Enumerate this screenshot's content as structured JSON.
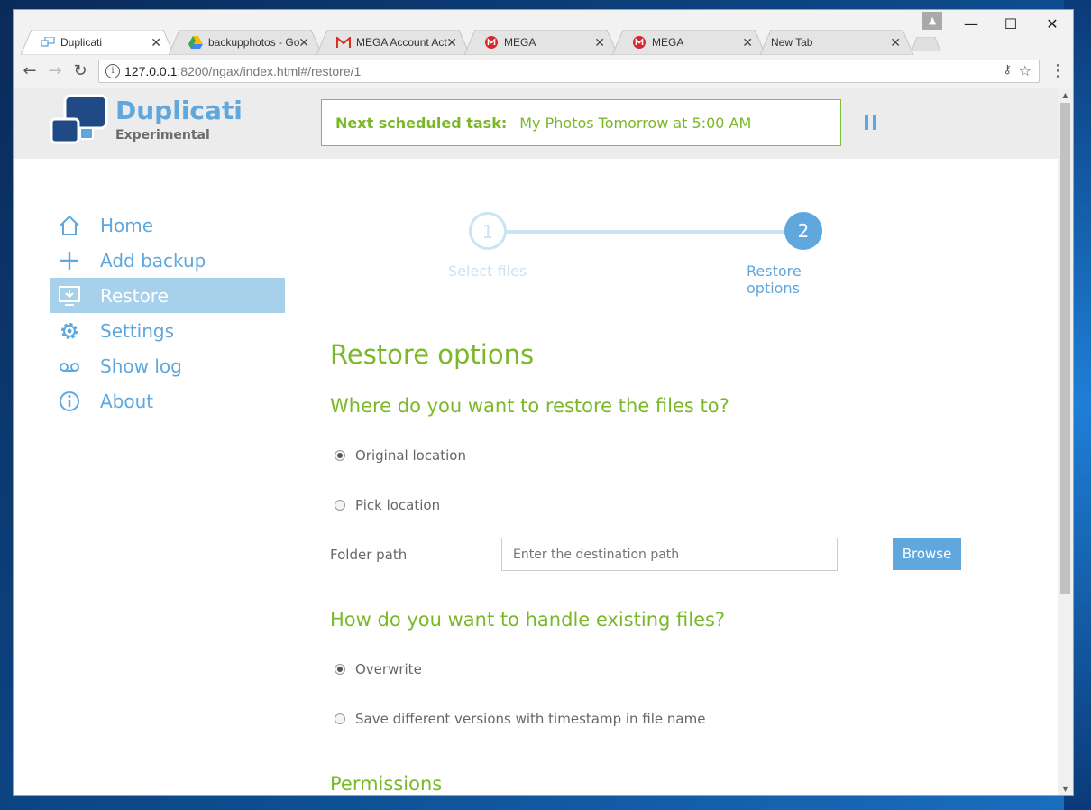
{
  "tabs": [
    {
      "title": "Duplicati",
      "favicon": "duplicati-favicon",
      "active": true
    },
    {
      "title": "backupphotos - Go",
      "favicon": "google-drive-icon",
      "active": false
    },
    {
      "title": "MEGA Account Act",
      "favicon": "gmail-icon",
      "active": false
    },
    {
      "title": "MEGA",
      "favicon": "mega-icon",
      "active": false
    },
    {
      "title": "MEGA",
      "favicon": "mega-icon",
      "active": false
    },
    {
      "title": "New Tab",
      "favicon": "",
      "active": false
    }
  ],
  "address": {
    "host": "127.0.0.1",
    "path": ":8200/ngax/index.html#/restore/1"
  },
  "header": {
    "brand": "Duplicati",
    "brand_sub": "Experimental",
    "sched_label": "Next scheduled task:",
    "sched_value": "My Photos Tomorrow at 5:00 AM"
  },
  "sidebar": {
    "items": [
      {
        "label": "Home",
        "icon": "home-icon"
      },
      {
        "label": "Add backup",
        "icon": "plus-icon"
      },
      {
        "label": "Restore",
        "icon": "restore-icon",
        "active": true
      },
      {
        "label": "Settings",
        "icon": "gear-icon"
      },
      {
        "label": "Show log",
        "icon": "log-icon"
      },
      {
        "label": "About",
        "icon": "info-icon"
      }
    ]
  },
  "stepper": {
    "step1_number": "1",
    "step1_label": "Select files",
    "step2_number": "2",
    "step2_label": "Restore options",
    "current_step": 2
  },
  "form": {
    "title": "Restore options",
    "where_heading": "Where do you want to restore the files to?",
    "opt_original": "Original location",
    "opt_pick": "Pick location",
    "folder_label": "Folder path",
    "folder_placeholder": "Enter the destination path",
    "browse_label": "Browse",
    "existing_heading": "How do you want to handle existing files?",
    "opt_overwrite": "Overwrite",
    "opt_versions": "Save different versions with timestamp in file name",
    "permissions_heading": "Permissions"
  },
  "colors": {
    "accent_blue": "#5fa7dc",
    "accent_green": "#7ab829"
  }
}
